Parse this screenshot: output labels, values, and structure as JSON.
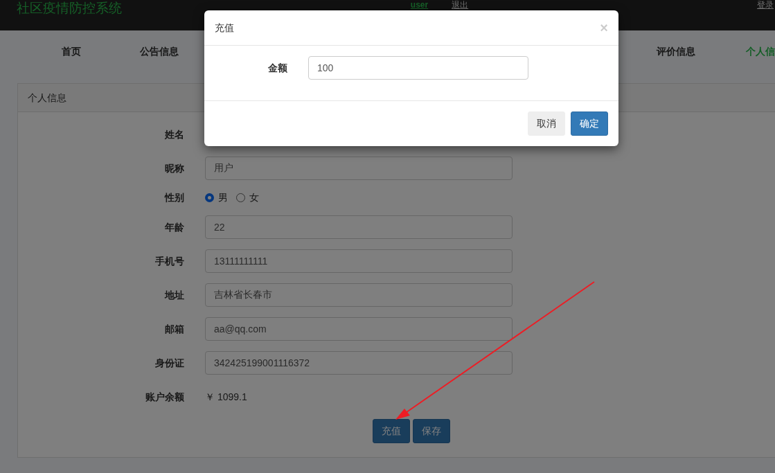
{
  "header": {
    "brand": "社区疫情防控系统",
    "user": "user",
    "logout": "退出",
    "login": "登录"
  },
  "nav": [
    {
      "label": "首页",
      "selected": false
    },
    {
      "label": "公告信息",
      "selected": false
    },
    {
      "label": "评价信息",
      "selected": false
    },
    {
      "label": "个人信",
      "selected": true
    }
  ],
  "panel": {
    "title": "个人信息",
    "fields": [
      {
        "kind": "hidden",
        "label": "姓名"
      },
      {
        "kind": "text",
        "label": "昵称",
        "value": "用户"
      },
      {
        "kind": "radio",
        "label": "性别",
        "options": [
          {
            "label": "男",
            "selected": true
          },
          {
            "label": "女",
            "selected": false
          }
        ]
      },
      {
        "kind": "text",
        "label": "年龄",
        "value": "22"
      },
      {
        "kind": "text",
        "label": "手机号",
        "value": "13111111111"
      },
      {
        "kind": "text",
        "label": "地址",
        "value": "吉林省长春市"
      },
      {
        "kind": "text",
        "label": "邮箱",
        "value": "aa@qq.com"
      },
      {
        "kind": "text",
        "label": "身份证",
        "value": "342425199001116372"
      },
      {
        "kind": "static",
        "label": "账户余额",
        "value": "￥ 1099.1"
      }
    ],
    "buttons": [
      "充值",
      "保存"
    ]
  },
  "modal": {
    "title": "充值",
    "close": "×",
    "label": "金额",
    "value": "100",
    "buttons": [
      {
        "label": "取消",
        "kind": "secondary"
      },
      {
        "label": "确定",
        "kind": "primary"
      }
    ]
  },
  "annotations": [
    {
      "kind": "arrow"
    }
  ]
}
